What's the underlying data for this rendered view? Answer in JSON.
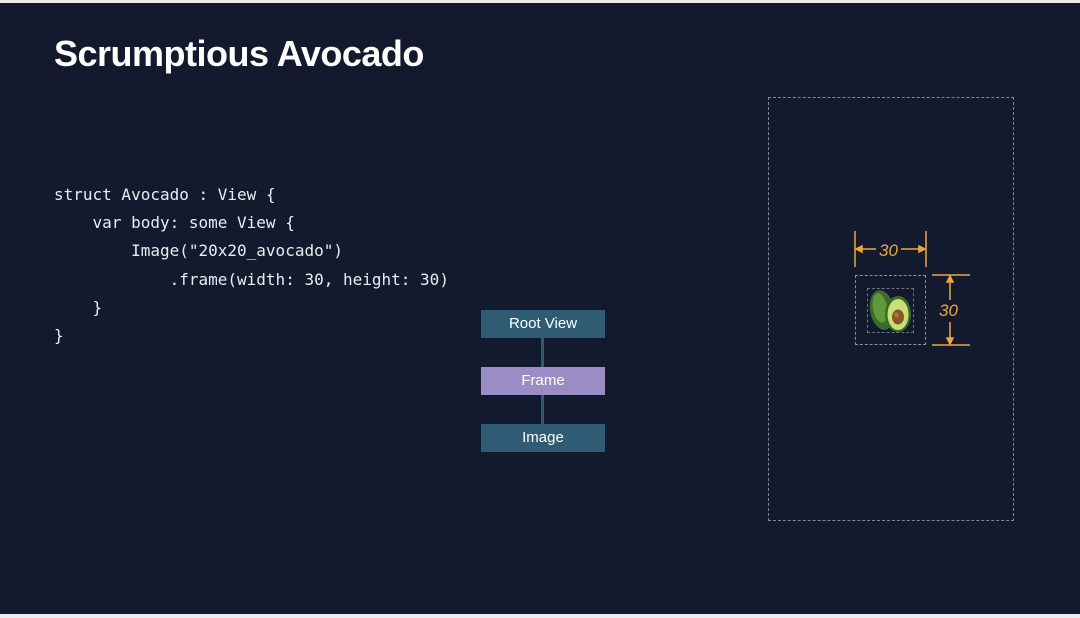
{
  "slide": {
    "title": "Scrumptious Avocado"
  },
  "code": {
    "lines": [
      "struct Avocado : View {",
      "    var body: some View {",
      "        Image(\"20x20_avocado\")",
      "            .frame(width: 30, height: 30)",
      "    }",
      "}"
    ]
  },
  "view_tree": {
    "nodes": [
      "Root View",
      "Frame",
      "Image"
    ]
  },
  "preview": {
    "width_label": "30",
    "height_label": "30",
    "image_icon": "avocado-icon"
  },
  "colors": {
    "background": "#141a2e",
    "node_default": "#2f5c74",
    "node_highlight": "#9a8dc6",
    "dimension_accent": "#f0a63e"
  }
}
